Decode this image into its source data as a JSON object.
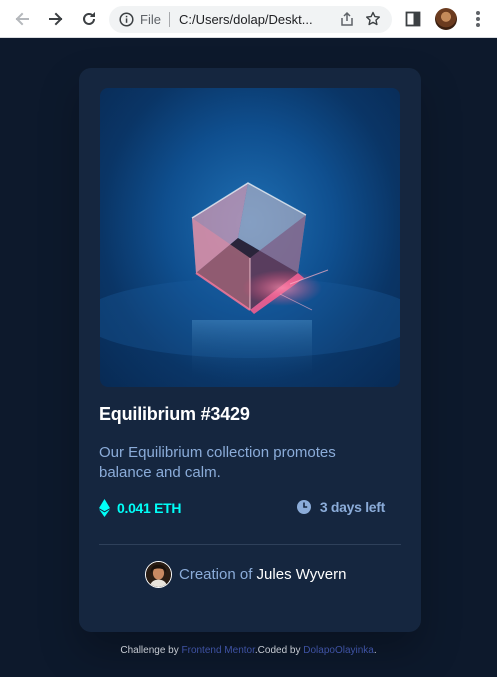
{
  "browser": {
    "file_label": "File",
    "url": "C:/Users/dolap/Deskt...",
    "icons": {
      "back": "arrow-left-icon",
      "forward": "arrow-right-icon",
      "reload": "reload-icon",
      "info": "info-icon",
      "share": "share-icon",
      "bookmark": "star-icon",
      "side_panel": "side-panel-icon",
      "menu": "kebab-menu-icon"
    }
  },
  "card": {
    "title": "Equilibrium #3429",
    "description": "Our Equilibrium collection promotes balance and calm.",
    "price": "0.041 ETH",
    "time_left": "3 days left",
    "creator_prefix": "Creation of",
    "creator_name": "Jules Wyvern"
  },
  "attribution": {
    "prefix": "Challenge by",
    "frontend_mentor": "Frontend Mentor",
    "coded_by": "Coded by",
    "author": "DolapoOlayinka"
  },
  "colors": {
    "page_bg": "#0d192c",
    "card_bg": "#15263f",
    "cyan": "#00fff8",
    "soft_blue": "#8bacd9",
    "white": "#ffffff"
  }
}
